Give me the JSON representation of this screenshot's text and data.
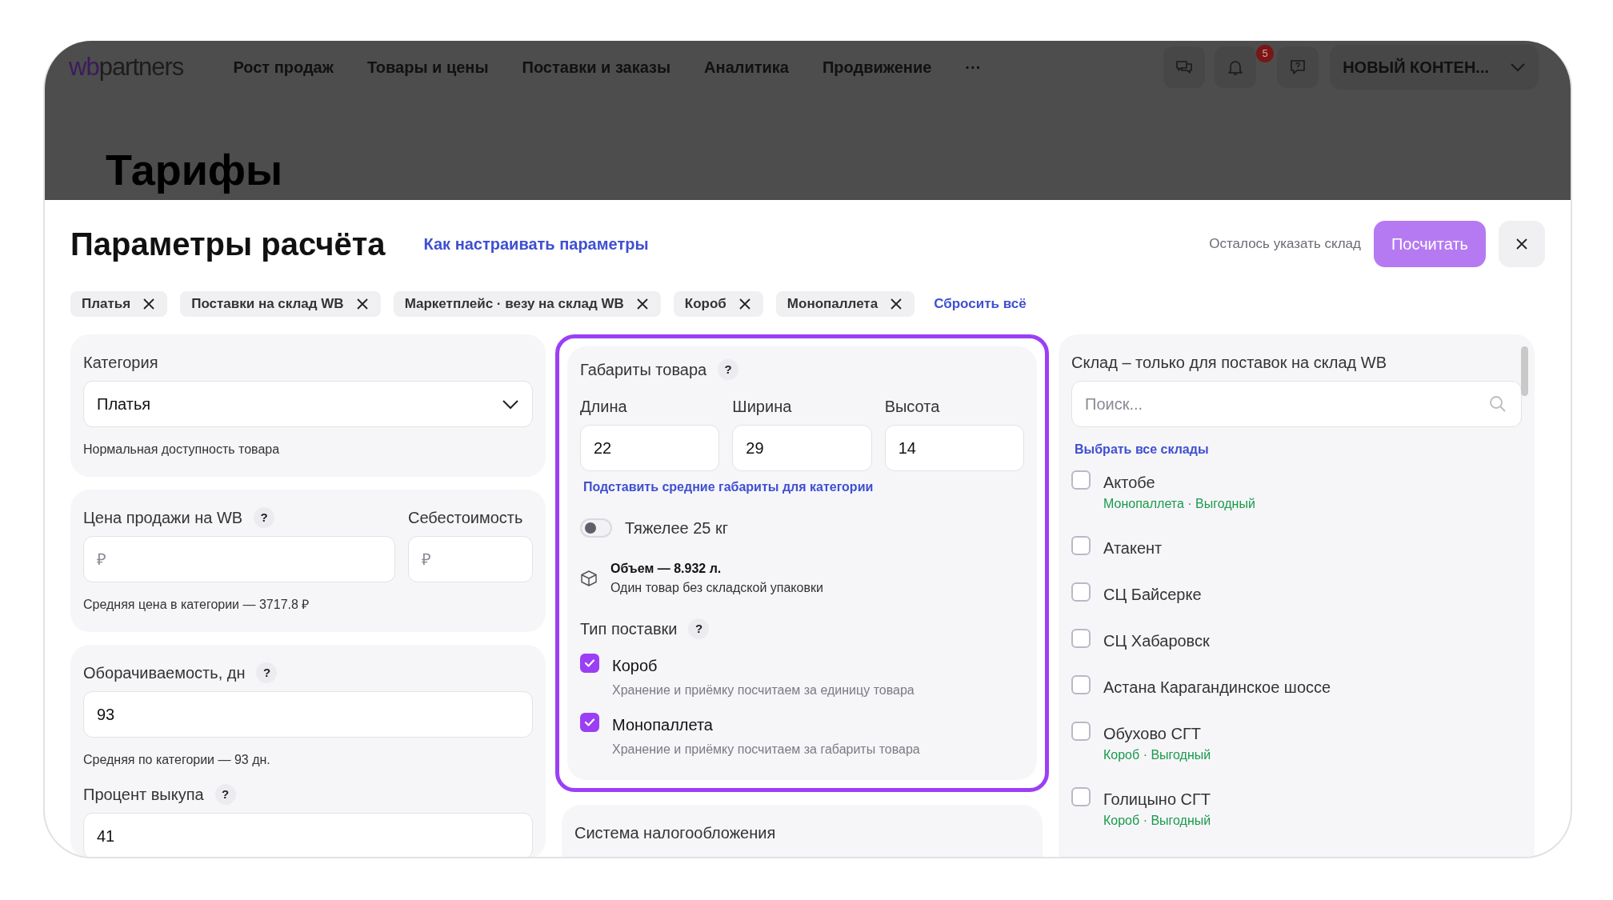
{
  "header": {
    "logo": {
      "prefix": "wb",
      "rest": "partners"
    },
    "nav": [
      {
        "label": "Рост продаж"
      },
      {
        "label": "Товары и цены"
      },
      {
        "label": "Поставки и заказы"
      },
      {
        "label": "Аналитика"
      },
      {
        "label": "Продвижение"
      }
    ],
    "more": "···",
    "notifications_badge": "5",
    "account": "НОВЫЙ КОНТЕН..."
  },
  "page_title": "Тарифы",
  "modal": {
    "title": "Параметры расчёта",
    "help_link": "Как настраивать параметры",
    "hint": "Осталось указать склад",
    "calculate_button": {
      "label": "Посчитать",
      "disabled": true
    },
    "chips": [
      {
        "label": "Платья"
      },
      {
        "label": "Поставки на склад WB"
      },
      {
        "label": "Маркетплейс · везу на склад WB"
      },
      {
        "label": "Короб"
      },
      {
        "label": "Монопаллета"
      }
    ],
    "reset_link": "Сбросить всё"
  },
  "category": {
    "label": "Категория",
    "value": "Платья",
    "caption": "Нормальная доступность товара"
  },
  "price": {
    "label": "Цена продажи на WB",
    "help": "?",
    "placeholder": "₽",
    "cost_label": "Себестоимость",
    "cost_placeholder": "₽",
    "caption": "Средняя цена в категории — 3717.8 ₽"
  },
  "turnover": {
    "label": "Оборачиваемость, дн",
    "help": "?",
    "value": "93",
    "caption": "Средняя по категории — 93 дн.",
    "buyout_label": "Процент выкупа",
    "buyout_help": "?",
    "buyout_value": "41"
  },
  "dimensions": {
    "label": "Габариты товара",
    "help": "?",
    "highlighted": true,
    "fields": [
      {
        "label": "Длина",
        "value": "22"
      },
      {
        "label": "Ширина",
        "value": "29"
      },
      {
        "label": "Высота",
        "value": "14"
      }
    ],
    "average_link": "Подставить средние габариты для категории",
    "heavy": {
      "label": "Тяжелее 25 кг",
      "on": false
    },
    "volume": "Объем — 8.932 л.",
    "volume_note": "Один товар без складской упаковки",
    "supply_label": "Тип поставки",
    "supply_help": "?",
    "supply_types": [
      {
        "label": "Короб",
        "note": "Хранение и приёмку посчитаем за единицу товара",
        "checked": true
      },
      {
        "label": "Монопаллета",
        "note": "Хранение и приёмку посчитаем за габариты товара",
        "checked": true
      }
    ]
  },
  "tax": {
    "label": "Система налогообложения"
  },
  "warehouses": {
    "label": "Склад – только для поставок на склад WB",
    "search_placeholder": "Поиск...",
    "select_all": "Выбрать все склады",
    "items": [
      {
        "name": "Актобе",
        "tag": "Монопаллета · Выгодный",
        "checked": false
      },
      {
        "name": "Атакент",
        "checked": false
      },
      {
        "name": "СЦ Байсерке",
        "checked": false
      },
      {
        "name": "СЦ Хабаровск",
        "checked": false
      },
      {
        "name": "Астана Карагандинское шоссе",
        "checked": false
      },
      {
        "name": "Обухово СГТ",
        "tag": "Короб · Выгодный",
        "checked": false
      },
      {
        "name": "Голицыно СГТ",
        "tag": "Короб · Выгодный",
        "checked": false
      }
    ]
  }
}
